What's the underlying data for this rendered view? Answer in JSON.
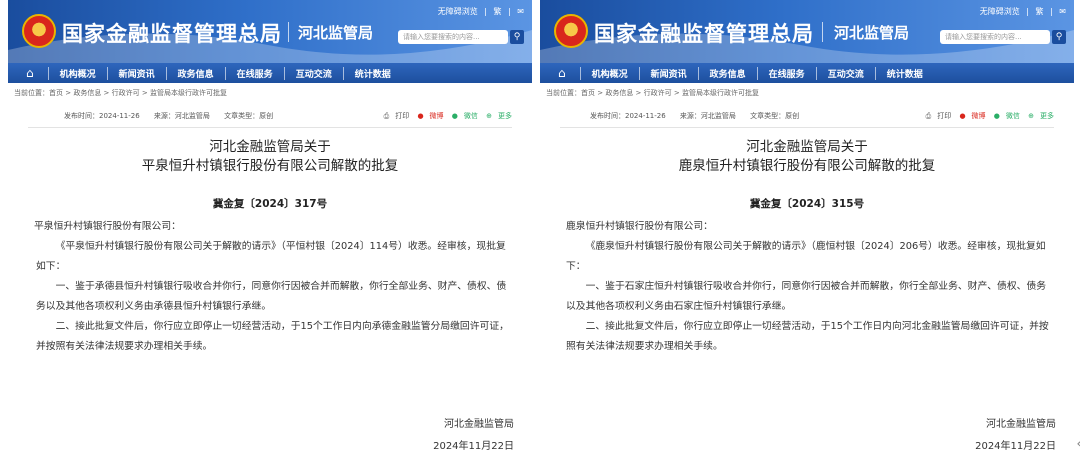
{
  "header": {
    "site_title": "国家金融监督管理总局",
    "bureau": "河北监管局",
    "top_links": [
      "无障碍浏览",
      "繁",
      "✉"
    ],
    "search_placeholder": "请输入您要搜索的内容...",
    "search_icon": "search-icon"
  },
  "nav": {
    "home_icon": "home-icon",
    "items": [
      "机构概况",
      "新闻资讯",
      "政务信息",
      "在线服务",
      "互动交流",
      "统计数据"
    ]
  },
  "breadcrumb": "当前位置：首页 > 政务信息 > 行政许可 > 监管局本级行政许可批复",
  "share": {
    "print": "打印",
    "weibo": "微博",
    "wechat": "微信",
    "more": "更多"
  },
  "docs": [
    {
      "meta_date": "发布时间：2024-11-26",
      "meta_source": "来源：河北监管局",
      "meta_type": "文章类型：原创",
      "title_line1": "河北金融监管局关于",
      "title_line2": "平泉恒升村镇银行股份有限公司解散的批复",
      "doc_no": "冀金复〔2024〕317号",
      "addressee": "平泉恒升村镇银行股份有限公司：",
      "para1": "《平泉恒升村镇银行股份有限公司关于解散的请示》（平恒村银〔2024〕114号）收悉。经审核，现批复如下：",
      "para2": "一、鉴于承德县恒升村镇银行吸收合并你行，同意你行因被合并而解散，你行全部业务、财产、债权、债务以及其他各项权利义务由承德县恒升村镇银行承继。",
      "para3": "二、接此批复文件后，你行应立即停止一切经营活动，于15个工作日内向承德金融监管分局缴回许可证，并按照有关法律法规要求办理相关手续。",
      "sign_org": "河北金融监管局",
      "sign_date": "2024年11月22日"
    },
    {
      "meta_date": "发布时间：2024-11-26",
      "meta_source": "来源：河北监管局",
      "meta_type": "文章类型：原创",
      "title_line1": "河北金融监管局关于",
      "title_line2": "鹿泉恒升村镇银行股份有限公司解散的批复",
      "doc_no": "冀金复〔2024〕315号",
      "addressee": "鹿泉恒升村镇银行股份有限公司：",
      "para1": "《鹿泉恒升村镇银行股份有限公司关于解散的请示》（鹿恒村银〔2024〕206号）收悉。经审核，现批复如下：",
      "para2": "一、鉴于石家庄恒升村镇银行吸收合并你行，同意你行因被合并而解散，你行全部业务、财产、债权、债务以及其他各项权利义务由石家庄恒升村镇银行承继。",
      "para3": "二、接此批复文件后，你行应立即停止一切经营活动，于15个工作日内向河北金融监管局缴回许可证，并按照有关法律法规要求办理相关手续。",
      "sign_org": "河北金融监管局",
      "sign_date": "2024年11月22日"
    }
  ]
}
